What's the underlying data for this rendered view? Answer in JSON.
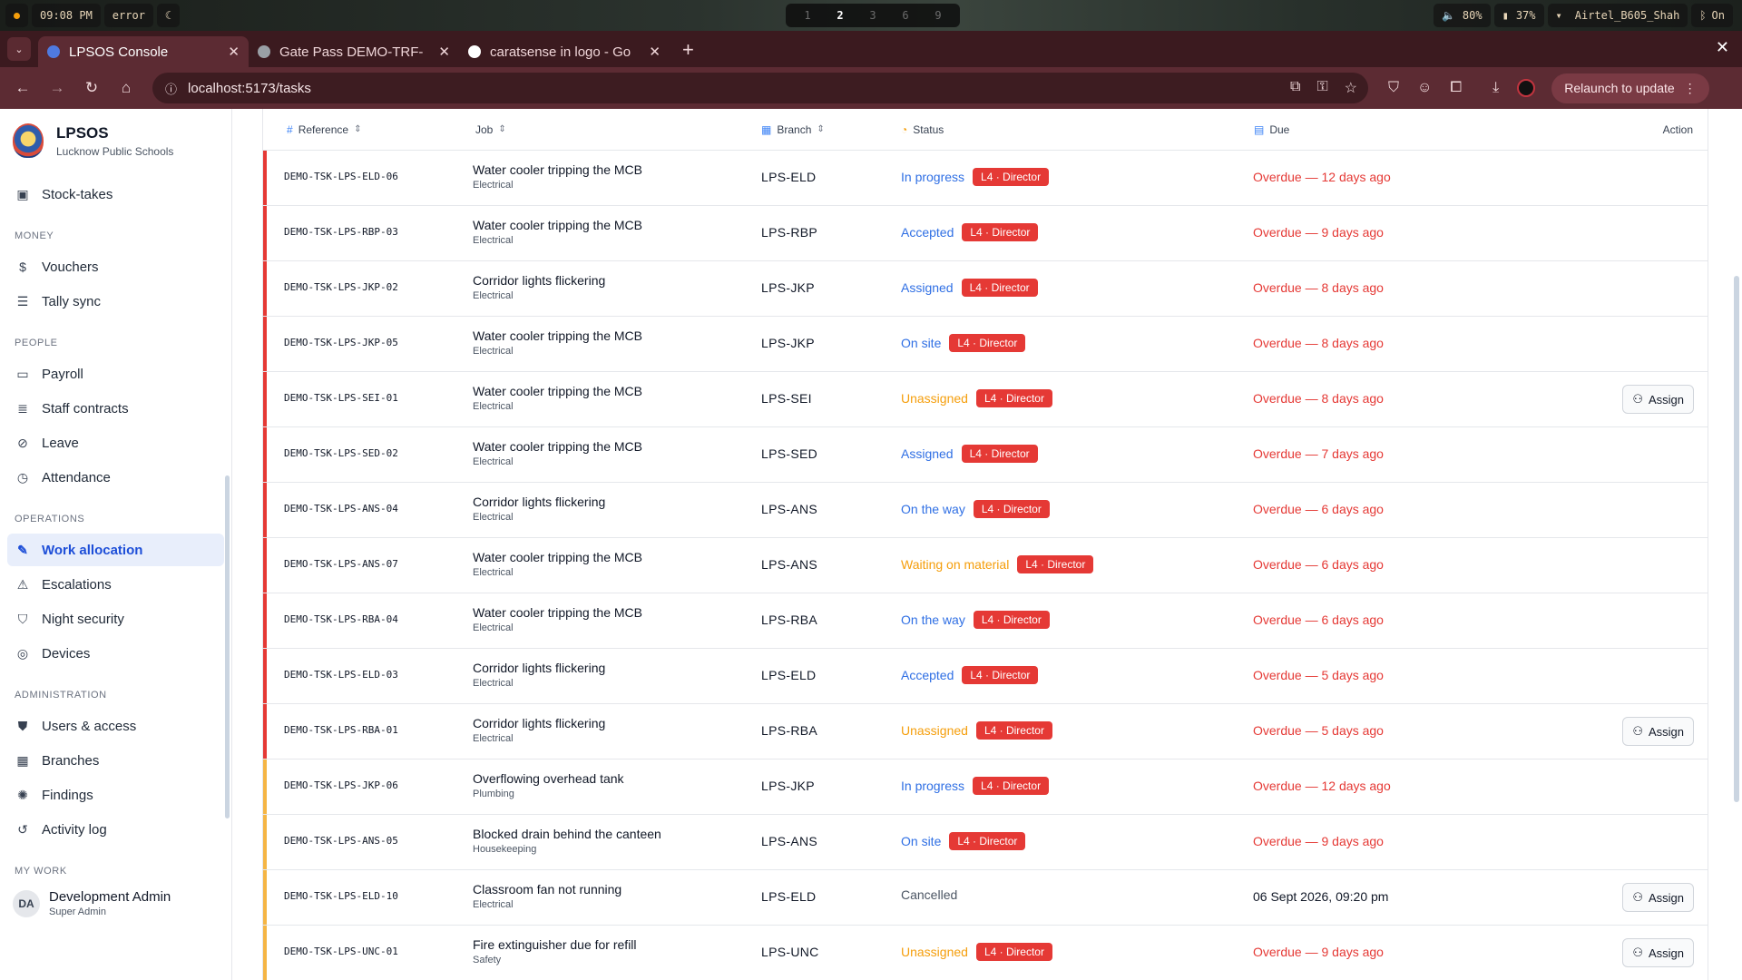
{
  "system": {
    "time": "09:08 PM",
    "error": "error",
    "moon": "☾",
    "workspaces": [
      "1",
      "2",
      "3",
      "6",
      "9"
    ],
    "active_workspace": "2",
    "volume": "80%",
    "battery": "37%",
    "wifi": "Airtel_B605_Shah",
    "bluetooth": "On"
  },
  "browser": {
    "tabs": [
      {
        "label": "LPSOS Console",
        "active": true
      },
      {
        "label": "Gate Pass DEMO-TRF-",
        "active": false
      },
      {
        "label": "caratsense in logo - Go",
        "active": false
      }
    ],
    "url": "localhost:5173/tasks",
    "relaunch": "Relaunch to update"
  },
  "sidebar": {
    "brand": {
      "title": "LPSOS",
      "subtitle": "Lucknow Public Schools"
    },
    "top_items": [
      {
        "label": "Stock-takes",
        "icon": "clipboard-icon"
      }
    ],
    "sections": [
      {
        "title": "MONEY",
        "items": [
          {
            "label": "Vouchers",
            "icon": "receipt-icon"
          },
          {
            "label": "Tally sync",
            "icon": "server-icon"
          }
        ]
      },
      {
        "title": "PEOPLE",
        "items": [
          {
            "label": "Payroll",
            "icon": "wallet-icon"
          },
          {
            "label": "Staff contracts",
            "icon": "contract-icon"
          },
          {
            "label": "Leave",
            "icon": "calendar-off-icon"
          },
          {
            "label": "Attendance",
            "icon": "clock-icon"
          }
        ]
      },
      {
        "title": "OPERATIONS",
        "items": [
          {
            "label": "Work allocation",
            "icon": "wrench-icon",
            "active": true
          },
          {
            "label": "Escalations",
            "icon": "alert-triangle-icon"
          },
          {
            "label": "Night security",
            "icon": "shield-icon"
          },
          {
            "label": "Devices",
            "icon": "fingerprint-icon"
          }
        ]
      },
      {
        "title": "ADMINISTRATION",
        "items": [
          {
            "label": "Users & access",
            "icon": "shield-check-icon"
          },
          {
            "label": "Branches",
            "icon": "building-icon"
          },
          {
            "label": "Findings",
            "icon": "sparkle-icon"
          },
          {
            "label": "Activity log",
            "icon": "history-icon"
          }
        ]
      }
    ],
    "my_work_title": "MY WORK",
    "user": {
      "initials": "DA",
      "name": "Development Admin",
      "role": "Super Admin"
    }
  },
  "table": {
    "headers": {
      "reference": "Reference",
      "job": "Job",
      "branch": "Branch",
      "status": "Status",
      "due": "Due",
      "action": "Action"
    },
    "assign_label": "Assign",
    "rows": [
      {
        "ref": "DEMO-TSK-LPS-ELD-06",
        "title": "Water cooler tripping the MCB",
        "cat": "Electrical",
        "branch": "LPS-ELD",
        "status": "In progress",
        "status_type": "blue",
        "badge": "L4 · Director",
        "due": "Overdue — 12 days ago",
        "overdue": true,
        "stripe": "red",
        "assign": false
      },
      {
        "ref": "DEMO-TSK-LPS-RBP-03",
        "title": "Water cooler tripping the MCB",
        "cat": "Electrical",
        "branch": "LPS-RBP",
        "status": "Accepted",
        "status_type": "blue",
        "badge": "L4 · Director",
        "due": "Overdue — 9 days ago",
        "overdue": true,
        "stripe": "red",
        "assign": false
      },
      {
        "ref": "DEMO-TSK-LPS-JKP-02",
        "title": "Corridor lights flickering",
        "cat": "Electrical",
        "branch": "LPS-JKP",
        "status": "Assigned",
        "status_type": "blue",
        "badge": "L4 · Director",
        "due": "Overdue — 8 days ago",
        "overdue": true,
        "stripe": "red",
        "assign": false
      },
      {
        "ref": "DEMO-TSK-LPS-JKP-05",
        "title": "Water cooler tripping the MCB",
        "cat": "Electrical",
        "branch": "LPS-JKP",
        "status": "On site",
        "status_type": "blue",
        "badge": "L4 · Director",
        "due": "Overdue — 8 days ago",
        "overdue": true,
        "stripe": "red",
        "assign": false
      },
      {
        "ref": "DEMO-TSK-LPS-SEI-01",
        "title": "Water cooler tripping the MCB",
        "cat": "Electrical",
        "branch": "LPS-SEI",
        "status": "Unassigned",
        "status_type": "orange",
        "badge": "L4 · Director",
        "due": "Overdue — 8 days ago",
        "overdue": true,
        "stripe": "red",
        "assign": true
      },
      {
        "ref": "DEMO-TSK-LPS-SED-02",
        "title": "Water cooler tripping the MCB",
        "cat": "Electrical",
        "branch": "LPS-SED",
        "status": "Assigned",
        "status_type": "blue",
        "badge": "L4 · Director",
        "due": "Overdue — 7 days ago",
        "overdue": true,
        "stripe": "red",
        "assign": false
      },
      {
        "ref": "DEMO-TSK-LPS-ANS-04",
        "title": "Corridor lights flickering",
        "cat": "Electrical",
        "branch": "LPS-ANS",
        "status": "On the way",
        "status_type": "blue",
        "badge": "L4 · Director",
        "due": "Overdue — 6 days ago",
        "overdue": true,
        "stripe": "red",
        "assign": false
      },
      {
        "ref": "DEMO-TSK-LPS-ANS-07",
        "title": "Water cooler tripping the MCB",
        "cat": "Electrical",
        "branch": "LPS-ANS",
        "status": "Waiting on material",
        "status_type": "orange",
        "badge": "L4 · Director",
        "due": "Overdue — 6 days ago",
        "overdue": true,
        "stripe": "red",
        "assign": false
      },
      {
        "ref": "DEMO-TSK-LPS-RBA-04",
        "title": "Water cooler tripping the MCB",
        "cat": "Electrical",
        "branch": "LPS-RBA",
        "status": "On the way",
        "status_type": "blue",
        "badge": "L4 · Director",
        "due": "Overdue — 6 days ago",
        "overdue": true,
        "stripe": "red",
        "assign": false
      },
      {
        "ref": "DEMO-TSK-LPS-ELD-03",
        "title": "Corridor lights flickering",
        "cat": "Electrical",
        "branch": "LPS-ELD",
        "status": "Accepted",
        "status_type": "blue",
        "badge": "L4 · Director",
        "due": "Overdue — 5 days ago",
        "overdue": true,
        "stripe": "red",
        "assign": false
      },
      {
        "ref": "DEMO-TSK-LPS-RBA-01",
        "title": "Corridor lights flickering",
        "cat": "Electrical",
        "branch": "LPS-RBA",
        "status": "Unassigned",
        "status_type": "orange",
        "badge": "L4 · Director",
        "due": "Overdue — 5 days ago",
        "overdue": true,
        "stripe": "red",
        "assign": true
      },
      {
        "ref": "DEMO-TSK-LPS-JKP-06",
        "title": "Overflowing overhead tank",
        "cat": "Plumbing",
        "branch": "LPS-JKP",
        "status": "In progress",
        "status_type": "blue",
        "badge": "L4 · Director",
        "due": "Overdue — 12 days ago",
        "overdue": true,
        "stripe": "amber",
        "assign": false
      },
      {
        "ref": "DEMO-TSK-LPS-ANS-05",
        "title": "Blocked drain behind the canteen",
        "cat": "Housekeeping",
        "branch": "LPS-ANS",
        "status": "On site",
        "status_type": "blue",
        "badge": "L4 · Director",
        "due": "Overdue — 9 days ago",
        "overdue": true,
        "stripe": "amber",
        "assign": false
      },
      {
        "ref": "DEMO-TSK-LPS-ELD-10",
        "title": "Classroom fan not running",
        "cat": "Electrical",
        "branch": "LPS-ELD",
        "status": "Cancelled",
        "status_type": "gray",
        "badge": "",
        "due": "06 Sept 2026, 09:20 pm",
        "overdue": false,
        "stripe": "amber",
        "assign": true
      },
      {
        "ref": "DEMO-TSK-LPS-UNC-01",
        "title": "Fire extinguisher due for refill",
        "cat": "Safety",
        "branch": "LPS-UNC",
        "status": "Unassigned",
        "status_type": "orange",
        "badge": "L4 · Director",
        "due": "Overdue — 9 days ago",
        "overdue": true,
        "stripe": "amber",
        "assign": true
      }
    ]
  },
  "colors": {
    "blue": "#2f6fe4",
    "orange": "#f59e0b",
    "gray": "#4b5563",
    "red": "#e53935",
    "amber": "#f5b544",
    "overdue": "#e53935"
  }
}
